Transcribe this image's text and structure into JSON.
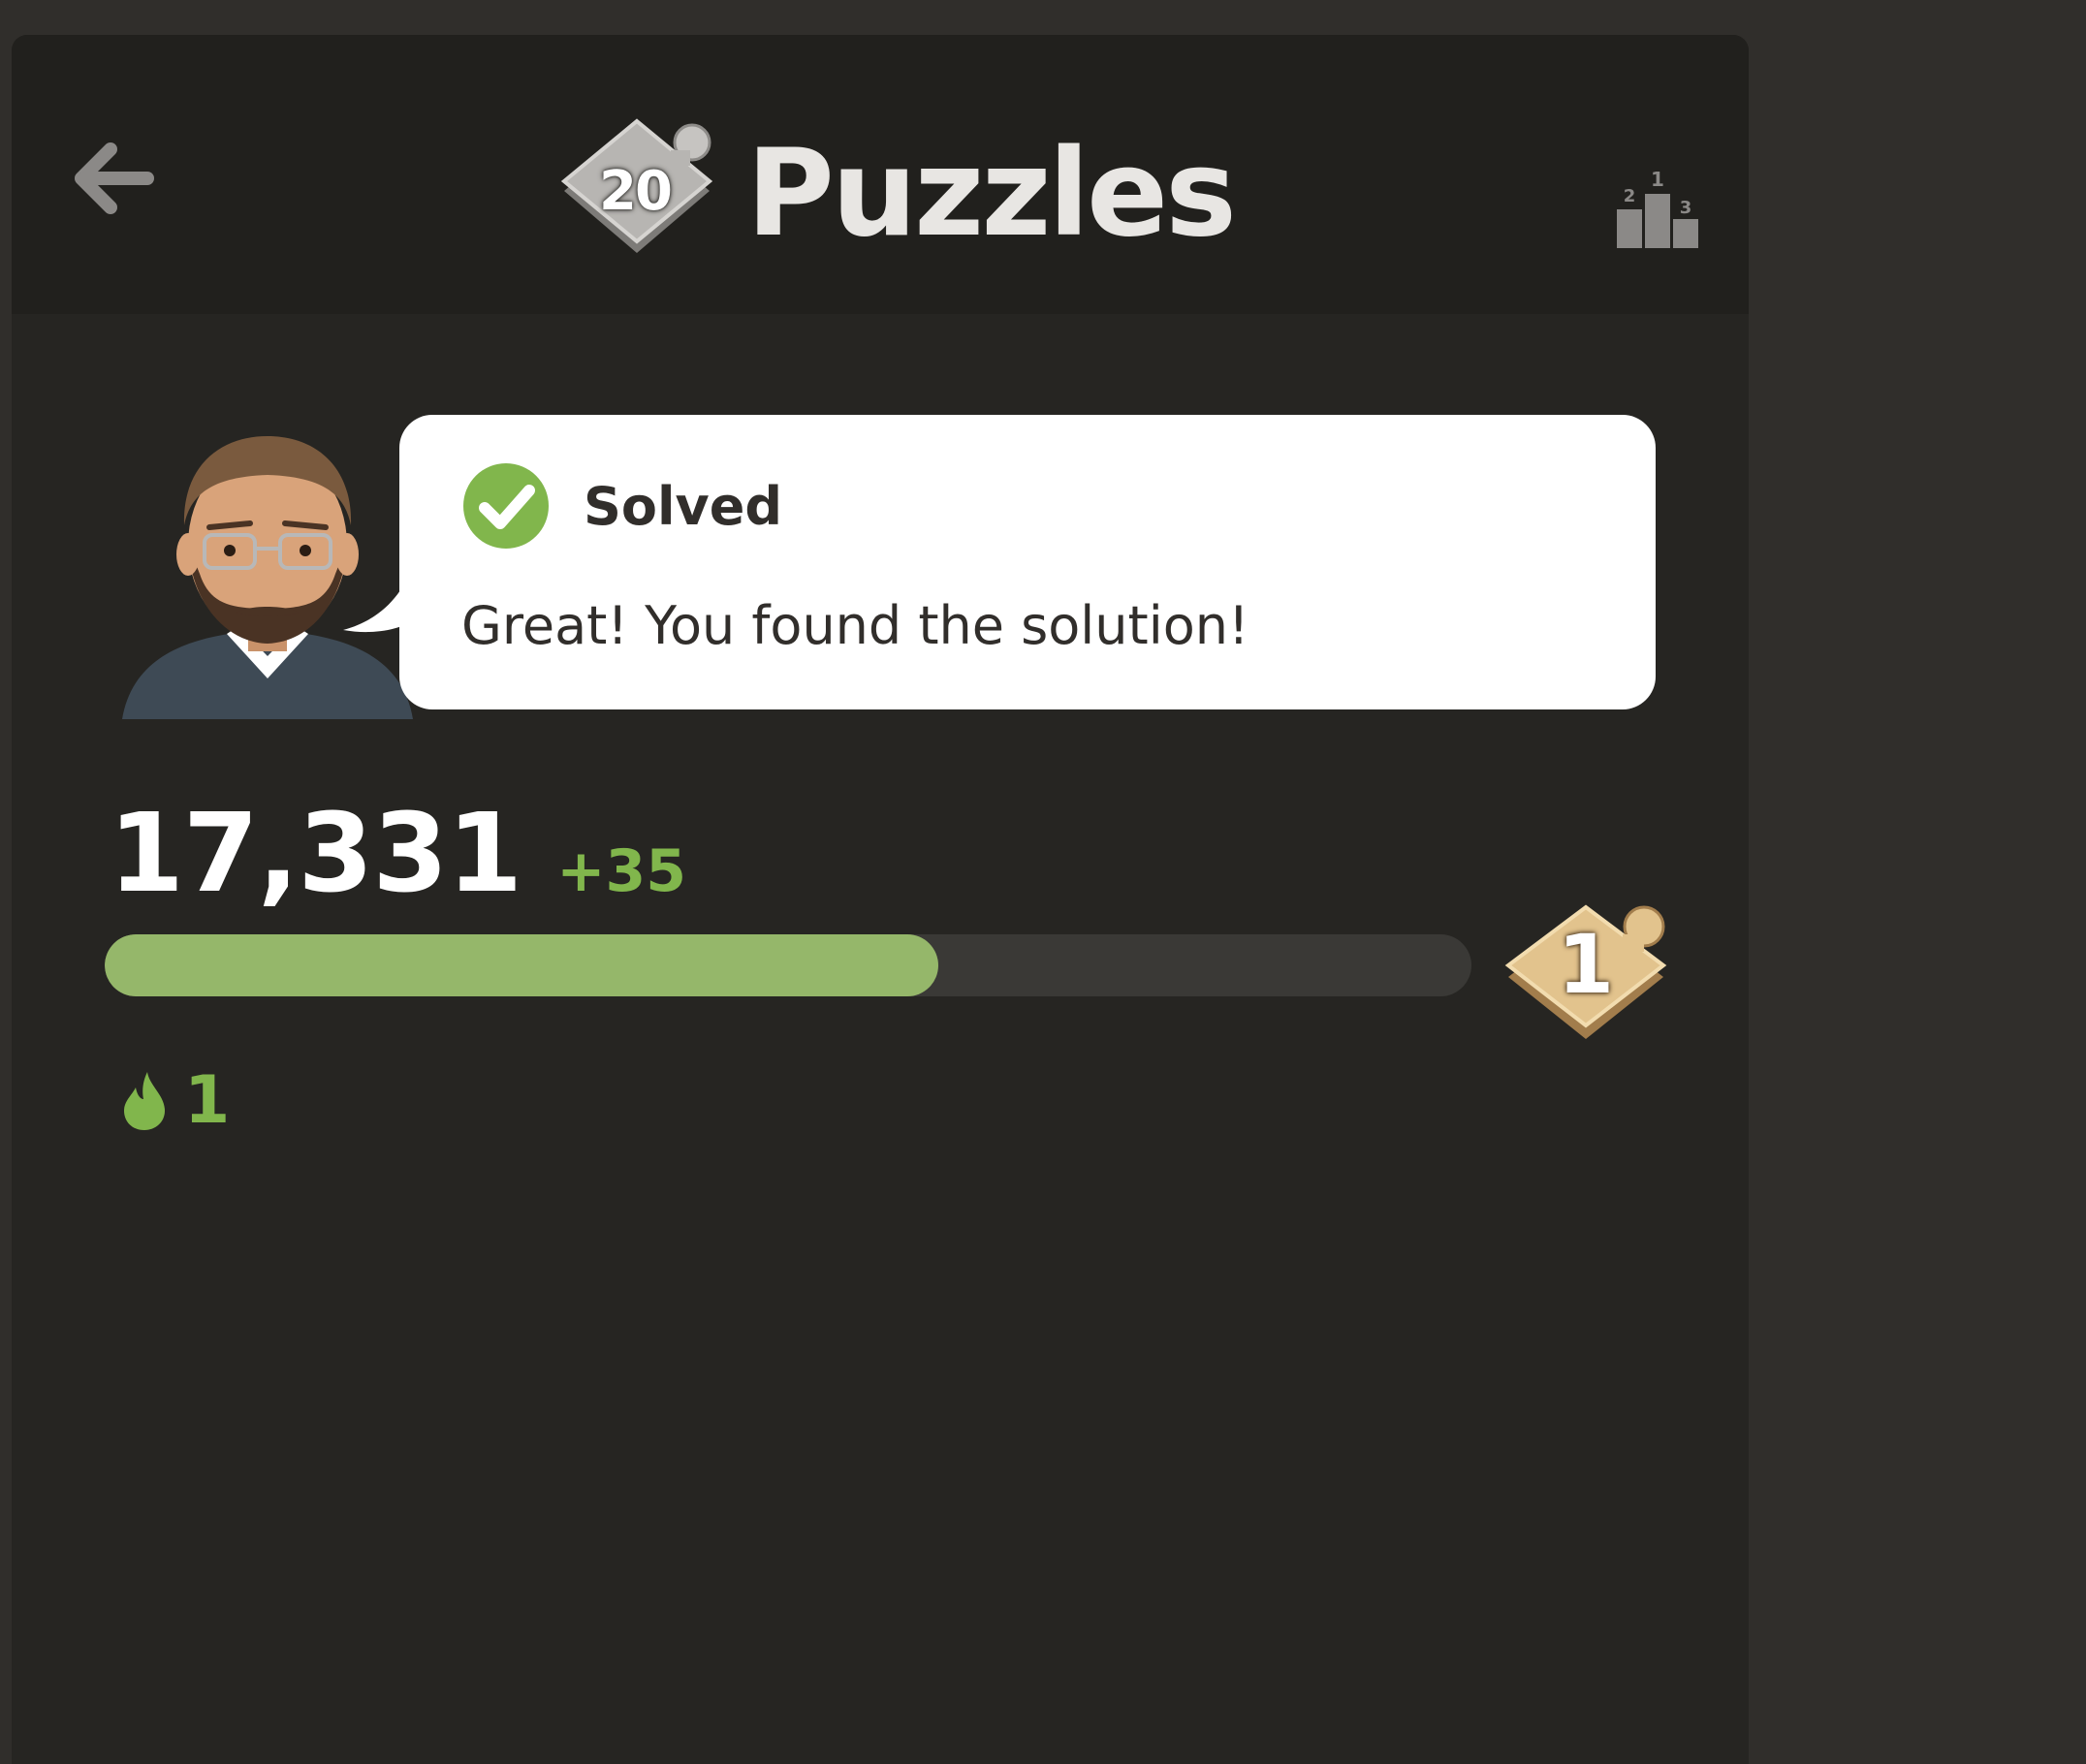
{
  "header": {
    "title": "Puzzles",
    "badge_number": "20",
    "back_icon": "arrow-left-icon",
    "leaderboard_icon": "podium-icon"
  },
  "feedback": {
    "status_icon": "check-circle-icon",
    "title": "Solved",
    "message": "Great! You found the solution!"
  },
  "rating": {
    "value": "17,331",
    "delta": "+35"
  },
  "progress": {
    "fraction": 0.61
  },
  "rank": {
    "value": "1"
  },
  "streak": {
    "icon": "flame-icon",
    "count": "1"
  },
  "colors": {
    "accent_green": "#81b64c",
    "progress_fill": "#95b76a",
    "panel_bg": "#262522",
    "header_bg": "#21201d"
  }
}
